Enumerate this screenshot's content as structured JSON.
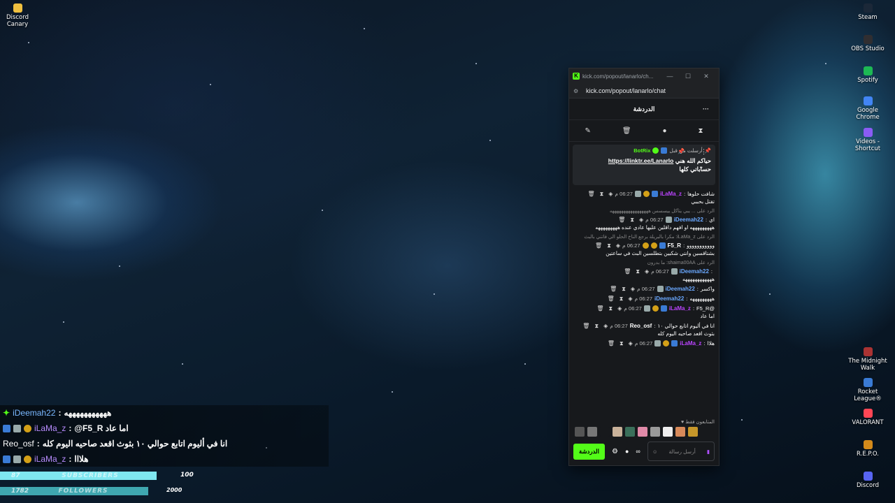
{
  "desktop_left": [
    {
      "label": "Discord\nCanary",
      "icon": "discord-canary-icon",
      "color": "#f0c040"
    }
  ],
  "desktop_right": [
    {
      "label": "Steam",
      "icon": "steam-icon",
      "color": "#1b2838"
    },
    {
      "label": "OBS Studio",
      "icon": "obs-icon",
      "color": "#302e31"
    },
    {
      "label": "Spotify",
      "icon": "spotify-icon",
      "color": "#1db954"
    },
    {
      "label": "Google Chrome",
      "icon": "chrome-icon",
      "color": "#4285f4"
    },
    {
      "label": "Videos - Shortcut",
      "icon": "videos-icon",
      "color": "#8a5cf5"
    },
    {
      "label": "The Midnight Walk",
      "icon": "midnight-walk-icon",
      "color": "#aa3333"
    },
    {
      "label": "Rocket League®",
      "icon": "rocket-league-icon",
      "color": "#3a7bd5"
    },
    {
      "label": "VALORANT",
      "icon": "valorant-icon",
      "color": "#ff4655"
    },
    {
      "label": "R.E.P.O.",
      "icon": "repo-icon",
      "color": "#d48a1a"
    },
    {
      "label": "Discord",
      "icon": "discord-icon",
      "color": "#5865f2"
    }
  ],
  "window": {
    "title": "kick.com/popout/lanarlo/ch...",
    "url": "kick.com/popout/lanarlo/chat",
    "chat_title": "الدردشة",
    "more": "···"
  },
  "pinned": {
    "prefix": "أرسلت من قبل",
    "bot": "BotRix",
    "link": "https://linktr.ee/Lanarlo",
    "text_after": "حياكم الله هني",
    "text_line2": "حساباتي كلها"
  },
  "messages": [
    {
      "type": "msg",
      "time": "06:27 م",
      "user": "iLaMa_z",
      "ucolor": "#b4f",
      "badges": [
        "sub",
        "gift",
        "cat"
      ],
      "text": "شافت حلوها",
      "line2": "تقتل بحببي"
    },
    {
      "type": "reply",
      "text": "الرد على ... يبي يتآكل ييسسس هههههههههههههههههه"
    },
    {
      "type": "msg",
      "time": "06:27 م",
      "user": "iDeemah22",
      "ucolor": "#6aa8ff",
      "badges": [
        "cat"
      ],
      "text": "اي",
      "line2": "هههههههههه او افهم داقلين عليها عادي عنده هههههههههه"
    },
    {
      "type": "reply",
      "text": "الرد على iLaMa_z: مكرا بالبريلة برجع الناخ الحلو الي فاتني بالبث"
    },
    {
      "type": "msg",
      "time": "06:27 م",
      "user": "F5_R",
      "ucolor": "#ffffff",
      "badges": [
        "sub",
        "gift",
        "gift2"
      ],
      "text": "ووووووووووو",
      "line2": "بشتاقسين وانتي شكيين بتطلسين البث في ساعتين"
    },
    {
      "type": "reply",
      "text": "الرد على shaima00AA: ما بدرون"
    },
    {
      "type": "msg",
      "time": "06:27 م",
      "user": "iDeemah22",
      "ucolor": "#6aa8ff",
      "badges": [
        "cat"
      ],
      "text": "",
      "line2": "ههههههههههههه"
    },
    {
      "type": "msg",
      "time": "06:27 م",
      "user": "iDeemah22",
      "ucolor": "#6aa8ff",
      "badges": [
        "cat"
      ],
      "text": "واكسر",
      "line2": ""
    },
    {
      "type": "msg",
      "time": "06:27 م",
      "user": "iDeemah22",
      "ucolor": "#6aa8ff",
      "badges": [],
      "text": "هههههههههه",
      "line2": ""
    },
    {
      "type": "msg",
      "time": "06:27 م",
      "user": "iLaMa_z",
      "ucolor": "#b4f",
      "badges": [
        "sub",
        "gift",
        "cat"
      ],
      "text": "@F5_R",
      "line2": "اما عاد"
    },
    {
      "type": "msg",
      "time": "06:27 م",
      "user": "Reo_osf",
      "ucolor": "#ffffff",
      "badges": [],
      "text": "انا في أليوم اتابع حوالي ١٠",
      "line2": "بثوث اقعد صاحيه اليوم كله"
    },
    {
      "type": "msg",
      "time": "06:27 م",
      "user": "iLaMa_z",
      "ucolor": "#b4f",
      "badges": [
        "sub",
        "gift",
        "cat"
      ],
      "text": "هلاا",
      "line2": ""
    }
  ],
  "followers_label": "المتابعون فقط",
  "input_placeholder": "أرسل رسالة",
  "chat_button": "الدردشة",
  "overlay": [
    {
      "user": "iDeemah22",
      "sep": ":",
      "text": "هههههههههههه",
      "style": "diamond"
    },
    {
      "user": "iLaMa_z",
      "sep": ":",
      "text": "@F5_R  اما عاد",
      "style": "badges"
    },
    {
      "user": "Reo_osf",
      "sep": ":",
      "text": "انا في أليوم اتابع حوالي ١٠ بثوث اقعد صاحيه اليوم كله",
      "style": "plain"
    },
    {
      "user": "iLaMa_z",
      "sep": ":",
      "text": "هلااا",
      "style": "badges"
    }
  ],
  "subs": {
    "label": "SUBSCRIBERS",
    "current": "87",
    "goal": "100",
    "progress": 0.87,
    "color": "#7fe7f0"
  },
  "follows": {
    "label": "FOLLOWERS",
    "current": "1782",
    "goal": "2000",
    "progress": 0.89,
    "color": "#3fa7b0"
  }
}
